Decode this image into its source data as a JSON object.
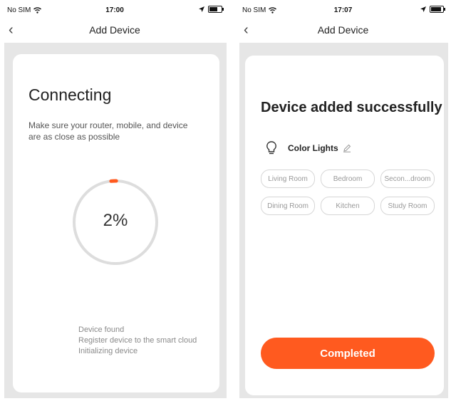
{
  "left": {
    "status": {
      "carrier": "No SIM",
      "time": "17:00",
      "battery_level": 0.7
    },
    "nav": {
      "title": "Add Device"
    },
    "connecting": {
      "title": "Connecting",
      "subtitle": "Make sure your router, mobile, and device are as close as possible",
      "progress_text": "2%",
      "progress_value": 0.02,
      "steps": [
        "Device found",
        "Register device to the smart cloud",
        "Initializing device"
      ]
    }
  },
  "right": {
    "status": {
      "carrier": "No SIM",
      "time": "17:07",
      "battery_level": 0.9
    },
    "nav": {
      "title": "Add Device"
    },
    "success": {
      "title": "Device added successfully",
      "device_name": "Color Lights",
      "rooms": [
        "Living Room",
        "Bedroom",
        "Secon...droom",
        "Dining Room",
        "Kitchen",
        "Study Room"
      ],
      "button_label": "Completed"
    }
  },
  "colors": {
    "accent": "#ff5a1f",
    "ring": "#dddddd",
    "background_grey": "#e6e6e6"
  }
}
